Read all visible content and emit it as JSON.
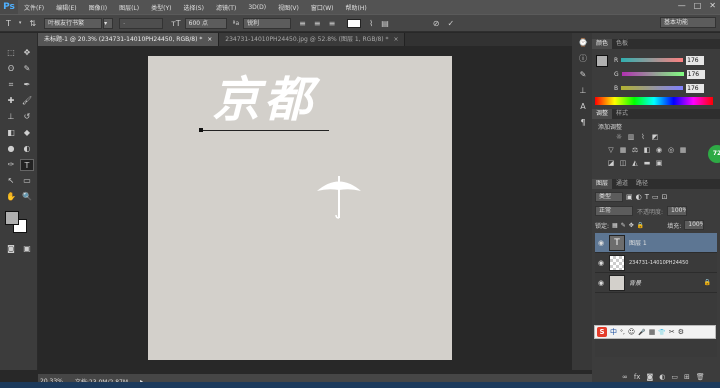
{
  "app": {
    "logo": "Ps"
  },
  "menu": [
    "文件(F)",
    "编辑(E)",
    "图像(I)",
    "图层(L)",
    "类型(Y)",
    "选择(S)",
    "滤镜(T)",
    "3D(D)",
    "视图(V)",
    "窗口(W)",
    "帮助(H)"
  ],
  "window_controls": [
    "—",
    "□",
    "✕"
  ],
  "options_bar": {
    "font_family": "叶根友行书繁",
    "font_style": "-",
    "font_size": "600 点",
    "aa_label": "ªa",
    "anti_alias": "锐利",
    "workspace": "基本功能"
  },
  "doc_tabs": [
    {
      "label": "未标题-1 @ 20.3% (234731-14010PH24450, RGB/8) *",
      "close": "×"
    },
    {
      "label": "234731-14010PH24450.jpg @ 52.8% (图层 1, RGB/8) *",
      "close": "×"
    }
  ],
  "canvas": {
    "text": "京都",
    "bg_color": "#d3d0cb"
  },
  "status": {
    "zoom": "20.33%",
    "doc_info": "文档:23.0M/2.87M"
  },
  "color_panel": {
    "tabs": [
      "颜色",
      "色板"
    ],
    "channels": [
      {
        "label": "R",
        "value": "176"
      },
      {
        "label": "G",
        "value": "176"
      },
      {
        "label": "B",
        "value": "176"
      }
    ]
  },
  "adjustments_panel": {
    "tabs": [
      "调整",
      "样式"
    ],
    "subtitle": "添加调整"
  },
  "layers_panel": {
    "tabs": [
      "图层",
      "通道",
      "路径"
    ],
    "kind_filter": "类型",
    "blend_mode": "正常",
    "opacity_label": "不透明度:",
    "opacity_value": "100%",
    "lock_label": "锁定:",
    "fill_label": "填充:",
    "fill_value": "100%",
    "layers": [
      {
        "name": "图层 1",
        "type": "text",
        "selected": true
      },
      {
        "name": "234731-14010PH24450",
        "type": "image",
        "selected": false
      },
      {
        "name": "背景",
        "type": "background",
        "selected": false
      }
    ]
  },
  "badge": {
    "value": "72"
  },
  "ime_bar": {
    "logo": "S",
    "items": [
      "中",
      "°,",
      "☺",
      "🎤",
      "▦",
      "👕",
      "✂",
      "⚙"
    ]
  }
}
